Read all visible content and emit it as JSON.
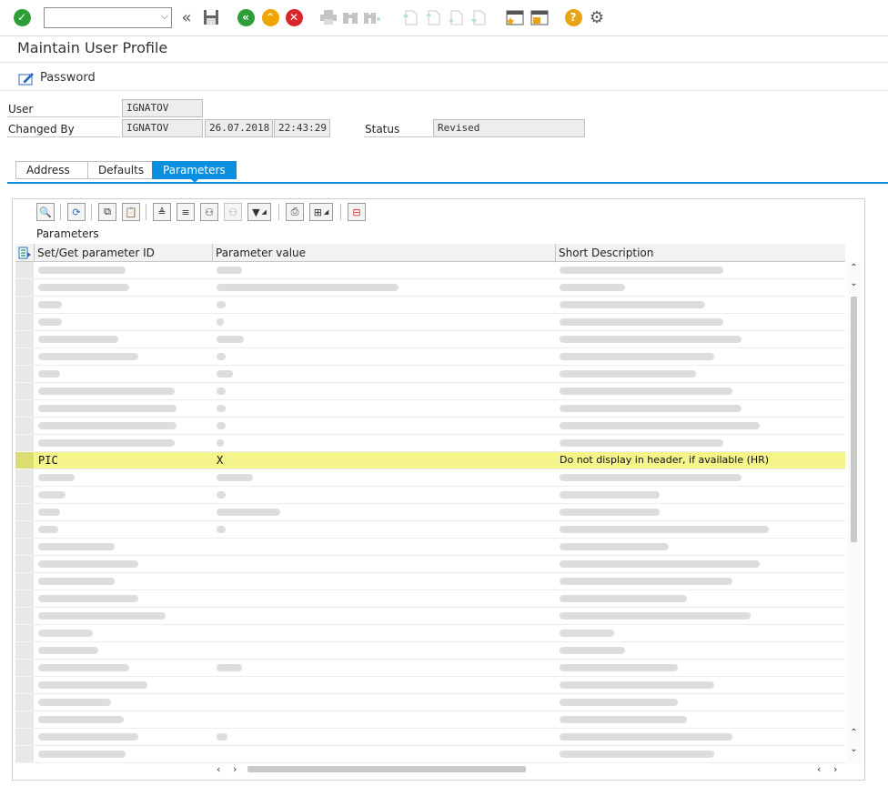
{
  "toolbar": {
    "command_value": "",
    "icons": [
      "enter-icon",
      "back-icon",
      "save-icon",
      "exit-icon",
      "exit-up-icon",
      "cancel-icon",
      "print-icon",
      "find-icon",
      "find-next-icon",
      "first-page-icon",
      "prev-page-icon",
      "next-page-icon",
      "last-page-icon",
      "new-session-icon",
      "shortcut-icon",
      "help-icon",
      "settings-gear-icon"
    ]
  },
  "page": {
    "title": "Maintain User Profile",
    "password_label": "Password"
  },
  "header_fields": {
    "user_label": "User",
    "user_value": "IGNATOV",
    "changed_by_label": "Changed By",
    "changed_by_value": "IGNATOV",
    "changed_date": "26.07.2018",
    "changed_time": "22:43:29",
    "status_label": "Status",
    "status_value": "Revised"
  },
  "tabs": [
    {
      "label": "Address",
      "active": false
    },
    {
      "label": "Defaults",
      "active": false
    },
    {
      "label": "Parameters",
      "active": true
    }
  ],
  "grid": {
    "title": "Parameters",
    "columns": [
      "Set/Get parameter ID",
      "Parameter value",
      "Short Description"
    ],
    "highlighted_row": {
      "id": "PIC",
      "value": "X",
      "description": "Do not display in header, if available (HR)"
    }
  },
  "colors": {
    "accent": "#0a8ee0",
    "highlight": "#f4f48a"
  }
}
